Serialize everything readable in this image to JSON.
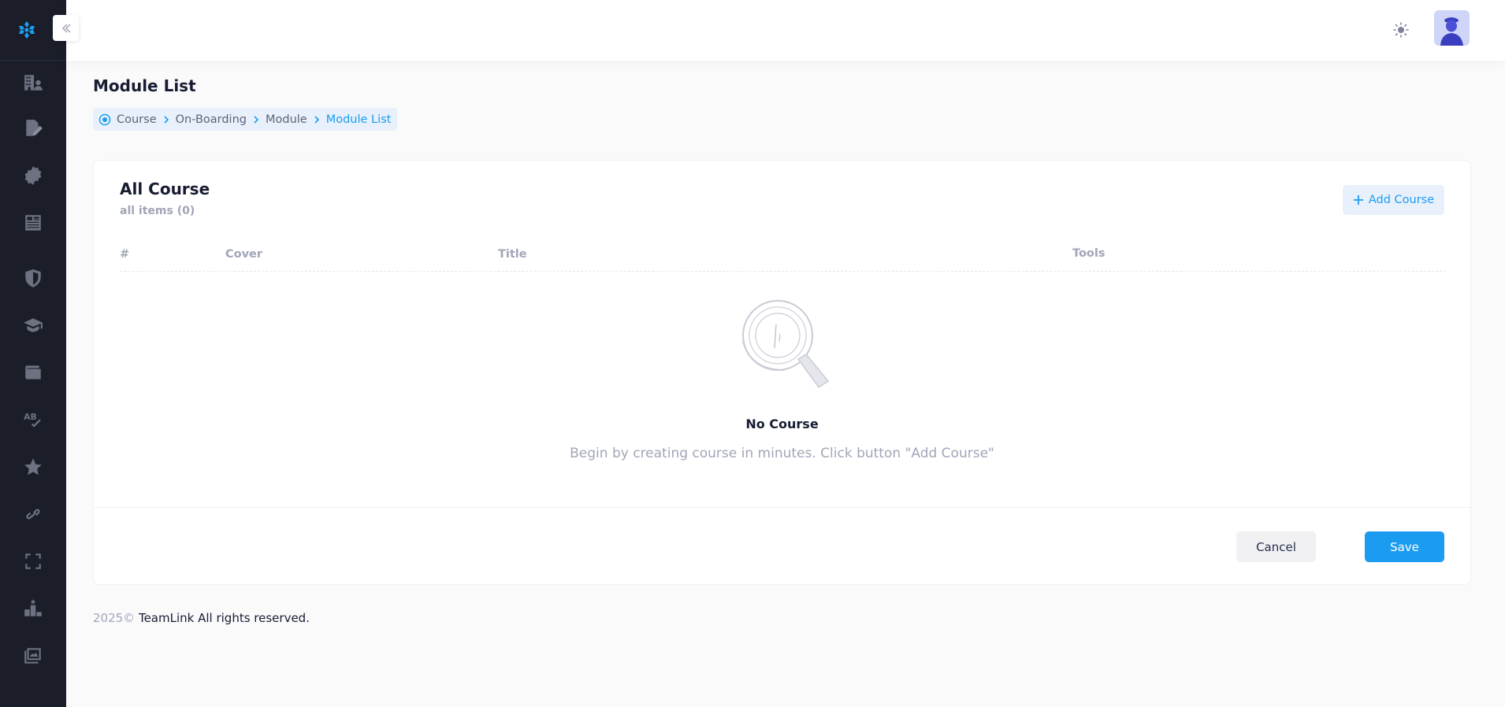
{
  "header": {
    "theme_icon": "sun-icon",
    "avatar_icon": "user-avatar"
  },
  "sidebar": {
    "logo_icon": "snowflake-logo-icon",
    "items": [
      {
        "icon": "building-users-icon"
      },
      {
        "icon": "file-signature-icon"
      },
      {
        "icon": "certificate-icon"
      },
      {
        "icon": "newspaper-icon"
      },
      {
        "icon": "shield-icon"
      },
      {
        "icon": "graduation-cap-icon"
      },
      {
        "icon": "wallet-icon"
      },
      {
        "icon": "spell-check-icon"
      },
      {
        "icon": "star-icon"
      },
      {
        "icon": "link-icon"
      },
      {
        "icon": "expand-icon"
      },
      {
        "icon": "ranking-icon"
      },
      {
        "icon": "images-icon"
      }
    ]
  },
  "page": {
    "title": "Module List",
    "breadcrumb": [
      "Course",
      "On-Boarding",
      "Module",
      "Module List"
    ]
  },
  "card": {
    "title": "All Course",
    "subtitle": "all items (0)",
    "add_button": "Add Course",
    "columns": [
      "#",
      "Cover",
      "Title",
      "Tools"
    ],
    "empty_title": "No Course",
    "empty_desc": "Begin by creating course in minutes. Click button \"Add Course\"",
    "cancel": "Cancel",
    "save": "Save"
  },
  "footer": {
    "year": "2025©",
    "text": "TeamLink All rights reserved."
  },
  "colors": {
    "accent": "#1b9cf0",
    "sidebar_bg": "#1b1e29",
    "avatar_bg": "#cfd5f8"
  }
}
